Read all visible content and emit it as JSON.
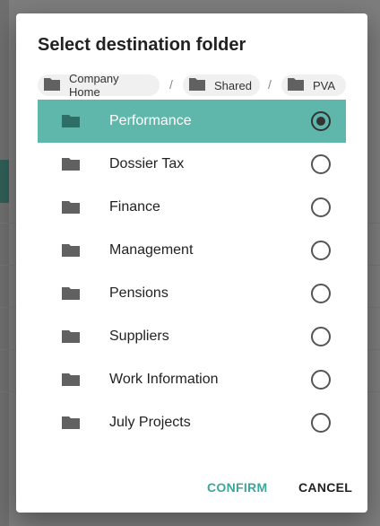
{
  "dialog": {
    "title": "Select destination folder"
  },
  "breadcrumbs": [
    {
      "label": "Company Home"
    },
    {
      "label": "Shared"
    },
    {
      "label": "PVA"
    }
  ],
  "breadcrumb_separator": "/",
  "folders": [
    {
      "label": "Performance",
      "selected": true
    },
    {
      "label": "Dossier Tax",
      "selected": false
    },
    {
      "label": "Finance",
      "selected": false
    },
    {
      "label": "Management",
      "selected": false
    },
    {
      "label": "Pensions",
      "selected": false
    },
    {
      "label": "Suppliers",
      "selected": false
    },
    {
      "label": "Work Information",
      "selected": false
    },
    {
      "label": "July Projects",
      "selected": false
    }
  ],
  "actions": {
    "confirm_label": "CONFIRM",
    "cancel_label": "CANCEL"
  },
  "colors": {
    "accent": "#3aa79a",
    "selected_row": "#5fb6aa",
    "folder_icon": "#616161"
  },
  "icons": {
    "folder": "folder-icon",
    "radio_selected": "radio-selected-icon",
    "radio_unselected": "radio-unselected-icon"
  }
}
